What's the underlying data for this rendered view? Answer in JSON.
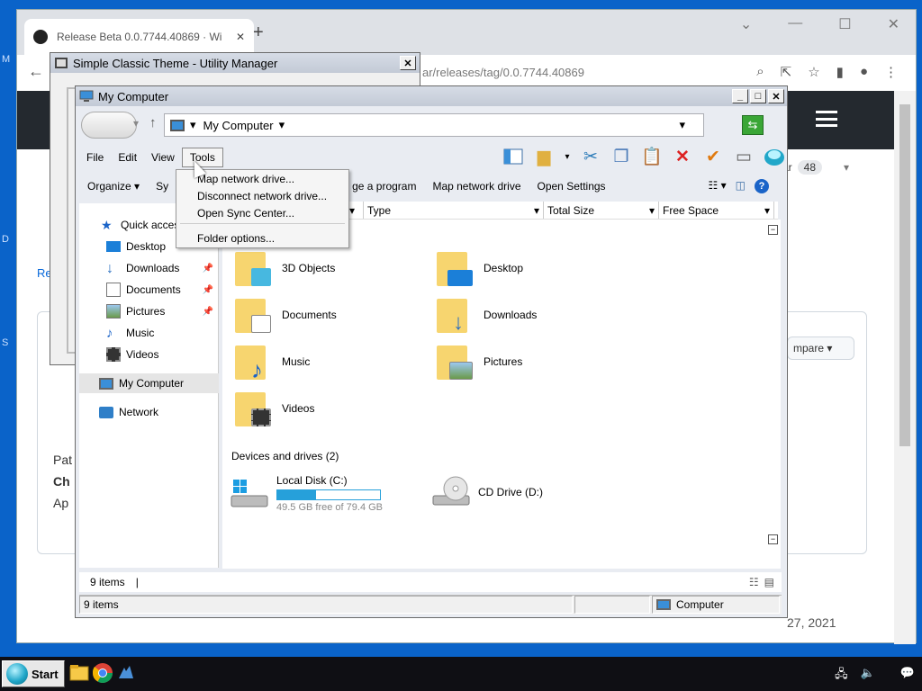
{
  "desktop": {
    "side_labels": [
      "M",
      "D",
      "S"
    ]
  },
  "taskbar": {
    "start_label": "Start"
  },
  "chrome": {
    "tab_title": "Release Beta 0.0.7744.40869 · Wi",
    "url": "ar/releases/tag/0.0.7744.40869",
    "star_label": "ar",
    "star_count": "48",
    "compare_label": "mpare",
    "date_fragment": "27, 2021",
    "frags": {
      "re": "Re",
      "pa": "Pat",
      "ch": "Ch",
      "ap": "Ap"
    }
  },
  "utility_manager": {
    "title": "Simple Classic Theme - Utility Manager"
  },
  "explorer": {
    "title": "My Computer",
    "address": "My Computer",
    "menu": [
      "File",
      "Edit",
      "View",
      "Tools"
    ],
    "commands": [
      "Organize",
      "Sy",
      "ge a program",
      "Map network drive",
      "Open Settings"
    ],
    "nav": {
      "quick_access": "Quick access",
      "items": [
        "Desktop",
        "Downloads",
        "Documents",
        "Pictures",
        "Music",
        "Videos"
      ],
      "my_computer": "My Computer",
      "network": "Network"
    },
    "columns": [
      "Type",
      "Total Size",
      "Free Space"
    ],
    "folders": [
      "3D Objects",
      "Desktop",
      "Documents",
      "Downloads",
      "Music",
      "Pictures",
      "Videos"
    ],
    "devices_header": "Devices and drives (2)",
    "drives": [
      {
        "name": "Local Disk (C:)",
        "free_text": "49.5 GB free of 79.4 GB",
        "used_fraction": 0.377
      },
      {
        "name": "CD Drive (D:)"
      }
    ],
    "status_items": "9 items",
    "status_bar_items": "9 items",
    "status_zone": "Computer"
  },
  "tools_menu": {
    "items": [
      "Map network drive...",
      "Disconnect network drive...",
      "Open Sync Center...",
      "Folder options..."
    ]
  }
}
